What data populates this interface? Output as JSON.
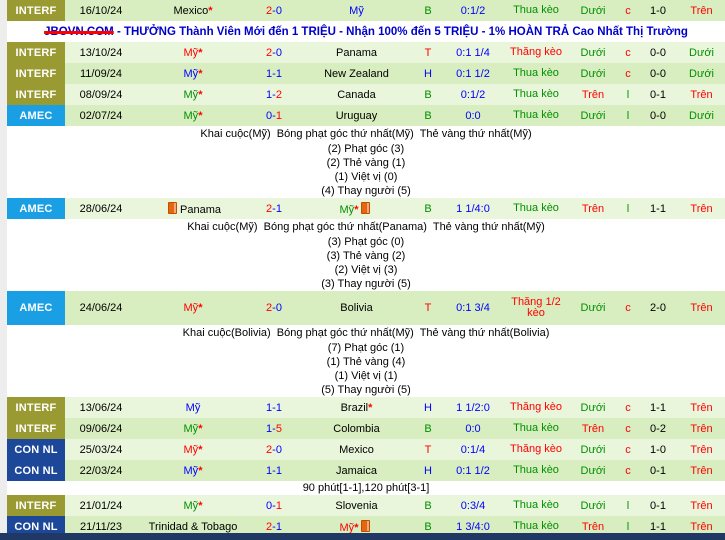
{
  "colors": {
    "green": "#009000",
    "red": "#ff0000",
    "blue": "#0000ff",
    "black": "#000000",
    "row_bg_a": "#d8eec0",
    "row_bg_b": "#eaf6dc",
    "bottom_bar": "#203864"
  },
  "league_colors": {
    "INTERF": "#9a9a33",
    "AMEC": "#1b9fe4",
    "CON NL": "#1d4899"
  },
  "ad": {
    "domain": "JBOVN.COM",
    "rest": " - THƯỞNG Thành Viên Mới đến 1 TRIỆU - Nhận 100% đến 5 TRIỆU - 1% HOÀN TRẢ Cao Nhất Thị Trường",
    "text_color": "#0000cc",
    "strike_color": "#ff0000"
  },
  "rows": [
    {
      "type": "match",
      "league": "INTERF",
      "date": "16/10/24",
      "home": {
        "name": "Mexico",
        "color": "#000000",
        "star": true,
        "red_card": false
      },
      "score": {
        "home": "2",
        "away": "0",
        "home_color": "#ff0000",
        "away_color": "#0000ff"
      },
      "away": {
        "name": "Mỹ",
        "color": "#0000ff",
        "star": false,
        "red_card": false
      },
      "ha": {
        "text": "B",
        "color": "#009000"
      },
      "odds": "0:1/2",
      "result": {
        "text": "Thua kèo",
        "color": "#009000"
      },
      "ou": {
        "text": "Dưới",
        "color": "#009000"
      },
      "corner_flag": {
        "text": "c",
        "color": "#ff0000"
      },
      "corner_score": "1-0",
      "corner_ou": {
        "text": "Trên",
        "color": "#ff0000"
      }
    },
    {
      "type": "ad"
    },
    {
      "type": "match",
      "league": "INTERF",
      "date": "13/10/24",
      "home": {
        "name": "Mỹ",
        "color": "#ff0000",
        "star": true,
        "red_card": false
      },
      "score": {
        "home": "2",
        "away": "0",
        "home_color": "#ff0000",
        "away_color": "#0000ff"
      },
      "away": {
        "name": "Panama",
        "color": "#000000",
        "star": false,
        "red_card": false
      },
      "ha": {
        "text": "T",
        "color": "#ff0000"
      },
      "odds": "0:1 1/4",
      "result": {
        "text": "Thắng kèo",
        "color": "#ff0000"
      },
      "ou": {
        "text": "Dưới",
        "color": "#009000"
      },
      "corner_flag": {
        "text": "c",
        "color": "#ff0000"
      },
      "corner_score": "0-0",
      "corner_ou": {
        "text": "Dưới",
        "color": "#009000"
      }
    },
    {
      "type": "match",
      "league": "INTERF",
      "date": "11/09/24",
      "home": {
        "name": "Mỹ",
        "color": "#0000ff",
        "star": true,
        "red_card": false
      },
      "score": {
        "home": "1",
        "away": "1",
        "home_color": "#0000ff",
        "away_color": "#0000ff"
      },
      "away": {
        "name": "New Zealand",
        "color": "#000000",
        "star": false,
        "red_card": false
      },
      "ha": {
        "text": "H",
        "color": "#0000ff"
      },
      "odds": "0:1 1/2",
      "result": {
        "text": "Thua kèo",
        "color": "#009000"
      },
      "ou": {
        "text": "Dưới",
        "color": "#009000"
      },
      "corner_flag": {
        "text": "c",
        "color": "#ff0000"
      },
      "corner_score": "0-0",
      "corner_ou": {
        "text": "Dưới",
        "color": "#009000"
      }
    },
    {
      "type": "match",
      "league": "INTERF",
      "date": "08/09/24",
      "home": {
        "name": "Mỹ",
        "color": "#009000",
        "star": true,
        "red_card": false
      },
      "score": {
        "home": "1",
        "away": "2",
        "home_color": "#0000ff",
        "away_color": "#ff0000"
      },
      "away": {
        "name": "Canada",
        "color": "#000000",
        "star": false,
        "red_card": false
      },
      "ha": {
        "text": "B",
        "color": "#009000"
      },
      "odds": "0:1/2",
      "result": {
        "text": "Thua kèo",
        "color": "#009000"
      },
      "ou": {
        "text": "Trên",
        "color": "#ff0000"
      },
      "corner_flag": {
        "text": "l",
        "color": "#009000"
      },
      "corner_score": "0-1",
      "corner_ou": {
        "text": "Trên",
        "color": "#ff0000"
      }
    },
    {
      "type": "match",
      "league": "AMEC",
      "date": "02/07/24",
      "home": {
        "name": "Mỹ",
        "color": "#009000",
        "star": true,
        "red_card": false
      },
      "score": {
        "home": "0",
        "away": "1",
        "home_color": "#0000ff",
        "away_color": "#ff0000"
      },
      "away": {
        "name": "Uruguay",
        "color": "#000000",
        "star": false,
        "red_card": false
      },
      "ha": {
        "text": "B",
        "color": "#009000"
      },
      "odds": "0:0",
      "result": {
        "text": "Thua kèo",
        "color": "#009000"
      },
      "ou": {
        "text": "Dưới",
        "color": "#009000"
      },
      "corner_flag": {
        "text": "l",
        "color": "#009000"
      },
      "corner_score": "0-0",
      "corner_ou": {
        "text": "Dưới",
        "color": "#009000"
      }
    },
    {
      "type": "detail",
      "lines": [
        "Khai cuộc(Mỹ)  Bóng phạt góc thứ nhất(Mỹ)  Thẻ vàng thứ nhất(Mỹ)",
        "(2) Phạt góc (3)",
        "(2) Thẻ vàng (1)",
        "(1) Việt vị (0)",
        "(4) Thay người (5)"
      ]
    },
    {
      "type": "match",
      "league": "AMEC",
      "date": "28/06/24",
      "home": {
        "name": "Panama",
        "color": "#000000",
        "star": false,
        "red_card": "before"
      },
      "score": {
        "home": "2",
        "away": "1",
        "home_color": "#ff0000",
        "away_color": "#0000ff"
      },
      "away": {
        "name": "Mỹ",
        "color": "#009000",
        "star": true,
        "red_card": "after"
      },
      "ha": {
        "text": "B",
        "color": "#009000"
      },
      "odds": "1 1/4:0",
      "result": {
        "text": "Thua kèo",
        "color": "#009000"
      },
      "ou": {
        "text": "Trên",
        "color": "#ff0000"
      },
      "corner_flag": {
        "text": "l",
        "color": "#009000"
      },
      "corner_score": "1-1",
      "corner_ou": {
        "text": "Trên",
        "color": "#ff0000"
      }
    },
    {
      "type": "detail",
      "lines": [
        "Khai cuộc(Mỹ)  Bóng phạt góc thứ nhất(Panama)  Thẻ vàng thứ nhất(Mỹ)",
        "(3) Phạt góc (0)",
        "(3) Thẻ vàng (2)",
        "(2) Việt vị (3)",
        "(3) Thay người (5)"
      ]
    },
    {
      "type": "match",
      "league": "AMEC",
      "date": "24/06/24",
      "tall": true,
      "home": {
        "name": "Mỹ",
        "color": "#ff0000",
        "star": true,
        "red_card": false
      },
      "score": {
        "home": "2",
        "away": "0",
        "home_color": "#ff0000",
        "away_color": "#0000ff"
      },
      "away": {
        "name": "Bolivia",
        "color": "#000000",
        "star": false,
        "red_card": false
      },
      "ha": {
        "text": "T",
        "color": "#ff0000"
      },
      "odds": "0:1 3/4",
      "result": {
        "text": "Thắng 1/2 kèo",
        "color": "#ff0000"
      },
      "ou": {
        "text": "Dưới",
        "color": "#009000"
      },
      "corner_flag": {
        "text": "c",
        "color": "#ff0000"
      },
      "corner_score": "2-0",
      "corner_ou": {
        "text": "Trên",
        "color": "#ff0000"
      }
    },
    {
      "type": "detail",
      "lines": [
        "Khai cuộc(Bolivia)  Bóng phạt góc thứ nhất(Mỹ)  Thẻ vàng thứ nhất(Bolivia)",
        "(7) Phạt góc (1)",
        "(1) Thẻ vàng (4)",
        "(1) Việt vị (1)",
        "(5) Thay người (5)"
      ]
    },
    {
      "type": "match",
      "league": "INTERF",
      "date": "13/06/24",
      "home": {
        "name": "Mỹ",
        "color": "#0000ff",
        "star": false,
        "red_card": false
      },
      "score": {
        "home": "1",
        "away": "1",
        "home_color": "#0000ff",
        "away_color": "#0000ff"
      },
      "away": {
        "name": "Brazil",
        "color": "#000000",
        "star": true,
        "red_card": false
      },
      "ha": {
        "text": "H",
        "color": "#0000ff"
      },
      "odds": "1 1/2:0",
      "result": {
        "text": "Thắng kèo",
        "color": "#ff0000"
      },
      "ou": {
        "text": "Dưới",
        "color": "#009000"
      },
      "corner_flag": {
        "text": "c",
        "color": "#ff0000"
      },
      "corner_score": "1-1",
      "corner_ou": {
        "text": "Trên",
        "color": "#ff0000"
      }
    },
    {
      "type": "match",
      "league": "INTERF",
      "date": "09/06/24",
      "home": {
        "name": "Mỹ",
        "color": "#009000",
        "star": true,
        "red_card": false
      },
      "score": {
        "home": "1",
        "away": "5",
        "home_color": "#0000ff",
        "away_color": "#ff0000"
      },
      "away": {
        "name": "Colombia",
        "color": "#000000",
        "star": false,
        "red_card": false
      },
      "ha": {
        "text": "B",
        "color": "#009000"
      },
      "odds": "0:0",
      "result": {
        "text": "Thua kèo",
        "color": "#009000"
      },
      "ou": {
        "text": "Trên",
        "color": "#ff0000"
      },
      "corner_flag": {
        "text": "c",
        "color": "#ff0000"
      },
      "corner_score": "0-2",
      "corner_ou": {
        "text": "Trên",
        "color": "#ff0000"
      }
    },
    {
      "type": "match",
      "league": "CON NL",
      "date": "25/03/24",
      "home": {
        "name": "Mỹ",
        "color": "#ff0000",
        "star": true,
        "red_card": false
      },
      "score": {
        "home": "2",
        "away": "0",
        "home_color": "#ff0000",
        "away_color": "#0000ff"
      },
      "away": {
        "name": "Mexico",
        "color": "#000000",
        "star": false,
        "red_card": false
      },
      "ha": {
        "text": "T",
        "color": "#ff0000"
      },
      "odds": "0:1/4",
      "result": {
        "text": "Thắng kèo",
        "color": "#ff0000"
      },
      "ou": {
        "text": "Dưới",
        "color": "#009000"
      },
      "corner_flag": {
        "text": "c",
        "color": "#ff0000"
      },
      "corner_score": "1-0",
      "corner_ou": {
        "text": "Trên",
        "color": "#ff0000"
      }
    },
    {
      "type": "match",
      "league": "CON NL",
      "date": "22/03/24",
      "home": {
        "name": "Mỹ",
        "color": "#0000ff",
        "star": true,
        "red_card": false
      },
      "score": {
        "home": "1",
        "away": "1",
        "home_color": "#0000ff",
        "away_color": "#0000ff"
      },
      "away": {
        "name": "Jamaica",
        "color": "#000000",
        "star": false,
        "red_card": false
      },
      "ha": {
        "text": "H",
        "color": "#0000ff"
      },
      "odds": "0:1 1/2",
      "result": {
        "text": "Thua kèo",
        "color": "#009000"
      },
      "ou": {
        "text": "Dưới",
        "color": "#009000"
      },
      "corner_flag": {
        "text": "c",
        "color": "#ff0000"
      },
      "corner_score": "0-1",
      "corner_ou": {
        "text": "Trên",
        "color": "#ff0000"
      }
    },
    {
      "type": "note",
      "text": "90 phút[1-1],120 phút[3-1]"
    },
    {
      "type": "match",
      "league": "INTERF",
      "date": "21/01/24",
      "home": {
        "name": "Mỹ",
        "color": "#009000",
        "star": true,
        "red_card": false
      },
      "score": {
        "home": "0",
        "away": "1",
        "home_color": "#0000ff",
        "away_color": "#ff0000"
      },
      "away": {
        "name": "Slovenia",
        "color": "#000000",
        "star": false,
        "red_card": false
      },
      "ha": {
        "text": "B",
        "color": "#009000"
      },
      "odds": "0:3/4",
      "result": {
        "text": "Thua kèo",
        "color": "#009000"
      },
      "ou": {
        "text": "Dưới",
        "color": "#009000"
      },
      "corner_flag": {
        "text": "l",
        "color": "#009000"
      },
      "corner_score": "0-1",
      "corner_ou": {
        "text": "Trên",
        "color": "#ff0000"
      }
    },
    {
      "type": "match",
      "league": "CON NL",
      "date": "21/11/23",
      "home": {
        "name": "Trinidad & Tobago",
        "color": "#000000",
        "star": false,
        "red_card": false
      },
      "score": {
        "home": "2",
        "away": "1",
        "home_color": "#ff0000",
        "away_color": "#0000ff"
      },
      "away": {
        "name": "Mỹ",
        "color": "#ff0000",
        "star": true,
        "red_card": "after"
      },
      "ha": {
        "text": "B",
        "color": "#009000"
      },
      "odds": "1 3/4:0",
      "result": {
        "text": "Thua kèo",
        "color": "#009000"
      },
      "ou": {
        "text": "Trên",
        "color": "#ff0000"
      },
      "corner_flag": {
        "text": "l",
        "color": "#009000"
      },
      "corner_score": "1-1",
      "corner_ou": {
        "text": "Trên",
        "color": "#ff0000"
      }
    }
  ]
}
